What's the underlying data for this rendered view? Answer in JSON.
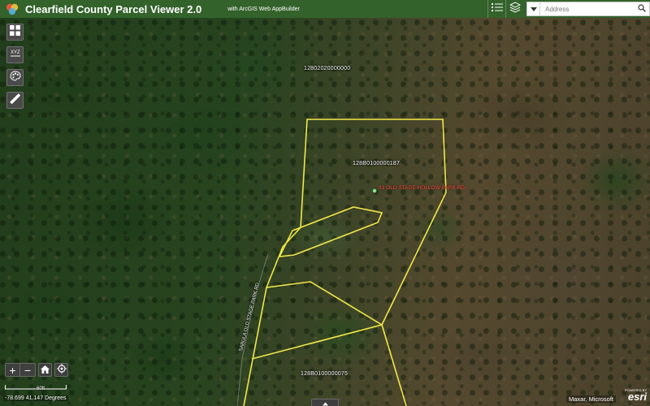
{
  "header": {
    "title": "Clearfield County Parcel Viewer 2.0",
    "subtitle": "with ArcGIS Web AppBuilder",
    "background_color": "#34622b"
  },
  "search": {
    "placeholder": "Address",
    "value": ""
  },
  "toolbar_icons": [
    "list-icon",
    "layers-icon"
  ],
  "left_tools": [
    "basemap-gallery-icon",
    "xyz-coordinate-icon",
    "legend-palette-icon",
    "measure-ruler-icon"
  ],
  "map": {
    "parcel_labels": {
      "top": "12802020000000",
      "center": "128B0100000187",
      "bottom": "128B0100000075"
    },
    "address_label": "81 OLD STAGE HOLLOW PARK RD",
    "road_label": "SABULA OLD STAGE PARK RD",
    "parcel_outline_color": "#f2e74a",
    "address_color": "#ff4a3a"
  },
  "zoom": {
    "in_label": "+",
    "out_label": "−"
  },
  "scalebar": {
    "label": "60ft"
  },
  "coordinates": "-78.699 41.147 Degrees",
  "attribution": "Maxar, Microsoft",
  "esri": {
    "powered_by": "POWERED BY",
    "logo_text": "esri"
  }
}
